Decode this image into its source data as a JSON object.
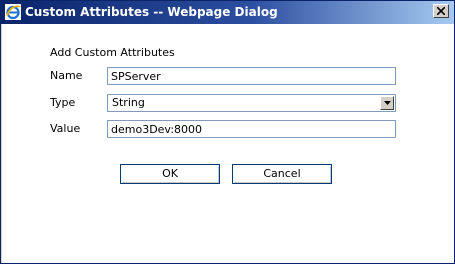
{
  "window": {
    "title": "Custom Attributes -- Webpage Dialog",
    "icon": "ie-icon",
    "close_icon": "close-icon"
  },
  "form": {
    "heading": "Add Custom Attributes",
    "name_label": "Name",
    "name_value": "SPServer",
    "type_label": "Type",
    "type_value": "String",
    "value_label": "Value",
    "value_value": "demo3Dev:8000"
  },
  "buttons": {
    "ok": "OK",
    "cancel": "Cancel"
  }
}
